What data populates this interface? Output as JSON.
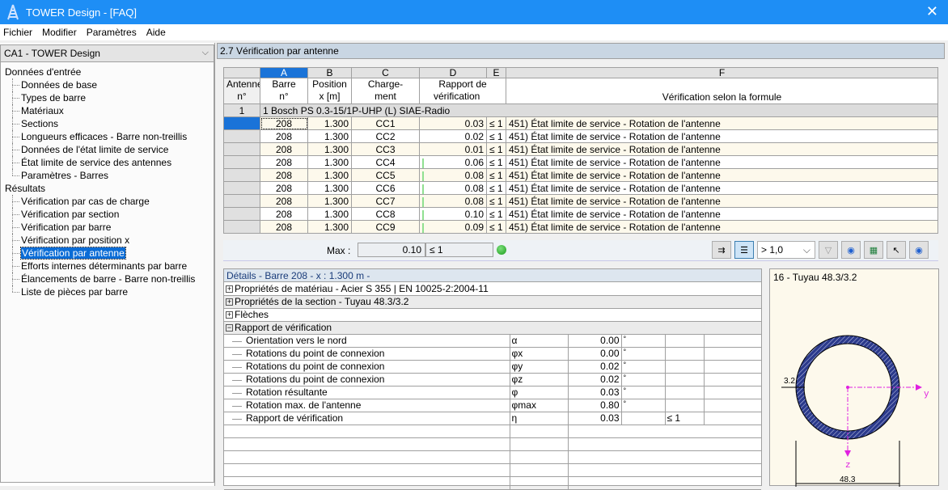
{
  "window": {
    "title": "TOWER Design - [FAQ]",
    "close_icon": "close-icon"
  },
  "menu": [
    {
      "label": "Fichier"
    },
    {
      "label": "Modifier"
    },
    {
      "label": "Paramètres"
    },
    {
      "label": "Aide"
    }
  ],
  "sidebar": {
    "combo_value": "CA1 - TOWER Design",
    "input_group": "Données d'entrée",
    "input_items": [
      "Données de base",
      "Types de barre",
      "Matériaux",
      "Sections",
      "Longueurs efficaces - Barre non-treillis",
      "Données de l'état limite de service",
      "État limite de service des antennes",
      "Paramètres - Barres"
    ],
    "results_group": "Résultats",
    "result_items": [
      "Vérification par cas de charge",
      "Vérification par section",
      "Vérification par barre",
      "Vérification par position x",
      "Vérification par antenne",
      "Efforts internes déterminants par barre",
      "Élancements de barre - Barre non-treillis",
      "Liste de pièces par barre"
    ],
    "selected": "Vérification par antenne"
  },
  "panel": {
    "title": "2.7 Vérification par antenne"
  },
  "grid": {
    "col_letters": [
      "A",
      "B",
      "C",
      "D",
      "E",
      "F"
    ],
    "headers": {
      "antenne": [
        "Antenne",
        "n°"
      ],
      "barre": [
        "Barre",
        "n°"
      ],
      "position": [
        "Position",
        "x [m]"
      ],
      "chargement": [
        "Charge-",
        "ment"
      ],
      "rapport": [
        "Rapport de",
        "vérification"
      ],
      "formule": "Vérification selon la formule"
    },
    "group": {
      "number": "1",
      "label": "1 Bosch PS 0.3-15/1P-UHP (L) SIAE-Radio"
    },
    "rows": [
      {
        "barre": "208",
        "x": "1.300",
        "cc": "CC1",
        "ratio": "0.03",
        "le": "≤ 1",
        "formule": "451) État limite de service - Rotation de l'antenne"
      },
      {
        "barre": "208",
        "x": "1.300",
        "cc": "CC2",
        "ratio": "0.02",
        "le": "≤ 1",
        "formule": "451) État limite de service - Rotation de l'antenne"
      },
      {
        "barre": "208",
        "x": "1.300",
        "cc": "CC3",
        "ratio": "0.01",
        "le": "≤ 1",
        "formule": "451) État limite de service - Rotation de l'antenne"
      },
      {
        "barre": "208",
        "x": "1.300",
        "cc": "CC4",
        "ratio": "0.06",
        "le": "≤ 1",
        "formule": "451) État limite de service - Rotation de l'antenne"
      },
      {
        "barre": "208",
        "x": "1.300",
        "cc": "CC5",
        "ratio": "0.08",
        "le": "≤ 1",
        "formule": "451) État limite de service - Rotation de l'antenne"
      },
      {
        "barre": "208",
        "x": "1.300",
        "cc": "CC6",
        "ratio": "0.08",
        "le": "≤ 1",
        "formule": "451) État limite de service - Rotation de l'antenne"
      },
      {
        "barre": "208",
        "x": "1.300",
        "cc": "CC7",
        "ratio": "0.08",
        "le": "≤ 1",
        "formule": "451) État limite de service - Rotation de l'antenne"
      },
      {
        "barre": "208",
        "x": "1.300",
        "cc": "CC8",
        "ratio": "0.10",
        "le": "≤ 1",
        "formule": "451) État limite de service - Rotation de l'antenne"
      },
      {
        "barre": "208",
        "x": "1.300",
        "cc": "CC9",
        "ratio": "0.09",
        "le": "≤ 1",
        "formule": "451) État limite de service - Rotation de l'antenne"
      }
    ],
    "max_label": "Max :",
    "max_value": "0.10",
    "max_le": "≤ 1",
    "filter_value": "> 1,0"
  },
  "details": {
    "title": "Détails - Barre 208 - x : 1.300 m -",
    "sections": [
      {
        "label": "Propriétés de matériau - Acier S 355 | EN 10025-2:2004-11",
        "expanded": false
      },
      {
        "label": "Propriétés de la section  -  Tuyau 48.3/3.2",
        "expanded": false
      },
      {
        "label": "Flèches",
        "expanded": false
      },
      {
        "label": "Rapport de vérification",
        "expanded": true
      }
    ],
    "rows": [
      {
        "label": "Orientation vers le nord",
        "symbol": "α",
        "value": "0.00",
        "unit": "°",
        "limit": ""
      },
      {
        "label": "Rotations du point de connexion",
        "symbol": "φx",
        "value": "0.00",
        "unit": "°",
        "limit": ""
      },
      {
        "label": "Rotations du point de connexion",
        "symbol": "φy",
        "value": "0.02",
        "unit": "°",
        "limit": ""
      },
      {
        "label": "Rotations du point de connexion",
        "symbol": "φz",
        "value": "0.02",
        "unit": "°",
        "limit": ""
      },
      {
        "label": "Rotation résultante",
        "symbol": "φ",
        "value": "0.03",
        "unit": "°",
        "limit": ""
      },
      {
        "label": "Rotation max. de l'antenne",
        "symbol": "φmax",
        "value": "0.80",
        "unit": "°",
        "limit": ""
      },
      {
        "label": "Rapport de vérification",
        "symbol": "η",
        "value": "0.03",
        "unit": "",
        "limit": "≤ 1"
      }
    ]
  },
  "preview": {
    "title": "16 - Tuyau 48.3/3.2",
    "thickness_label": "3.2",
    "diameter_label": "48.3",
    "axis_y": "y",
    "axis_z": "z",
    "section_color": "#2b3a8c",
    "axis_color": "#e020e0"
  },
  "colors": {
    "titlebar": "#1e8ef5",
    "selection": "#0a6cd6",
    "ok": "#1b9b1b"
  }
}
